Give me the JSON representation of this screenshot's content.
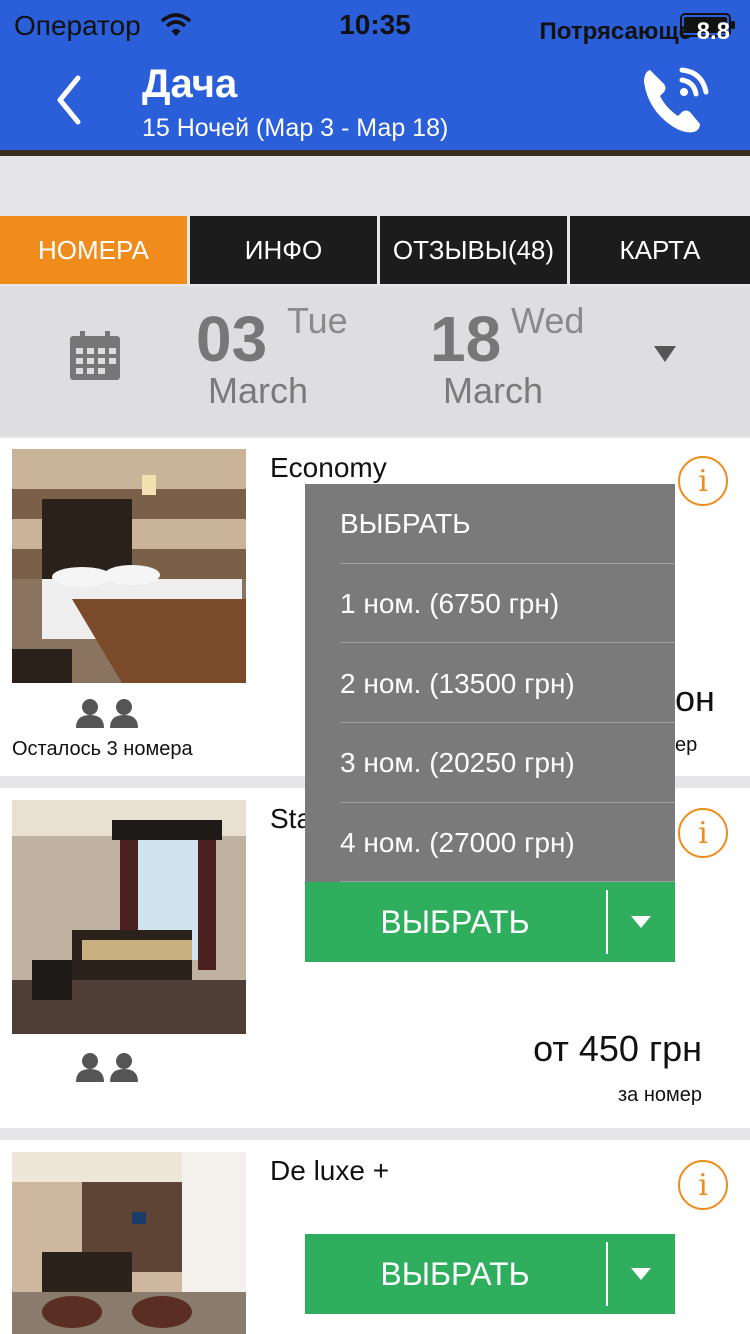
{
  "status_bar": {
    "carrier": "Оператор",
    "time": "10:35"
  },
  "header": {
    "title": "Дача",
    "subtitle": "15 Ночей (Мар 3 - Мар 18)"
  },
  "rating": {
    "label": "Потрясающе",
    "score": "8.8"
  },
  "tabs": [
    {
      "label": "НОМЕРА",
      "active": true
    },
    {
      "label": "ИНФО",
      "active": false
    },
    {
      "label": "ОТЗЫВЫ(48)",
      "active": false
    },
    {
      "label": "КАРТА",
      "active": false
    }
  ],
  "dates": {
    "checkin": {
      "day": "03",
      "weekday": "Tue",
      "month": "March"
    },
    "checkout": {
      "day": "18",
      "weekday": "Wed",
      "month": "March"
    }
  },
  "rooms": [
    {
      "name": "Economy",
      "rooms_left": "Осталось 3 номера",
      "price_partial": "он",
      "per_room_partial": "ер",
      "info_icon": "i"
    },
    {
      "name_partial": "Sta",
      "price": "от 450 грн",
      "per_room": "за номер",
      "select_label": "ВЫБРАТЬ",
      "info_icon": "i"
    },
    {
      "name": "De luxe +",
      "select_label": "ВЫБРАТЬ",
      "info_icon": "i"
    }
  ],
  "dropdown": {
    "items": [
      "ВЫБРАТЬ",
      "1 ном. (6750 грн)",
      "2 ном. (13500 грн)",
      "3 ном. (20250 грн)",
      "4 ном. (27000 грн)"
    ]
  },
  "colors": {
    "header": "#2a5fd9",
    "accent_orange": "#ef8c1b",
    "tab_dark": "#1c1c1c",
    "select_green": "#2fae5e",
    "dropdown_gray": "#7a7a7a"
  },
  "icons": [
    "back-chevron-icon",
    "phone-icon",
    "wifi-icon",
    "battery-icon",
    "calendar-icon",
    "info-icon",
    "person-icon",
    "caret-down-icon"
  ]
}
